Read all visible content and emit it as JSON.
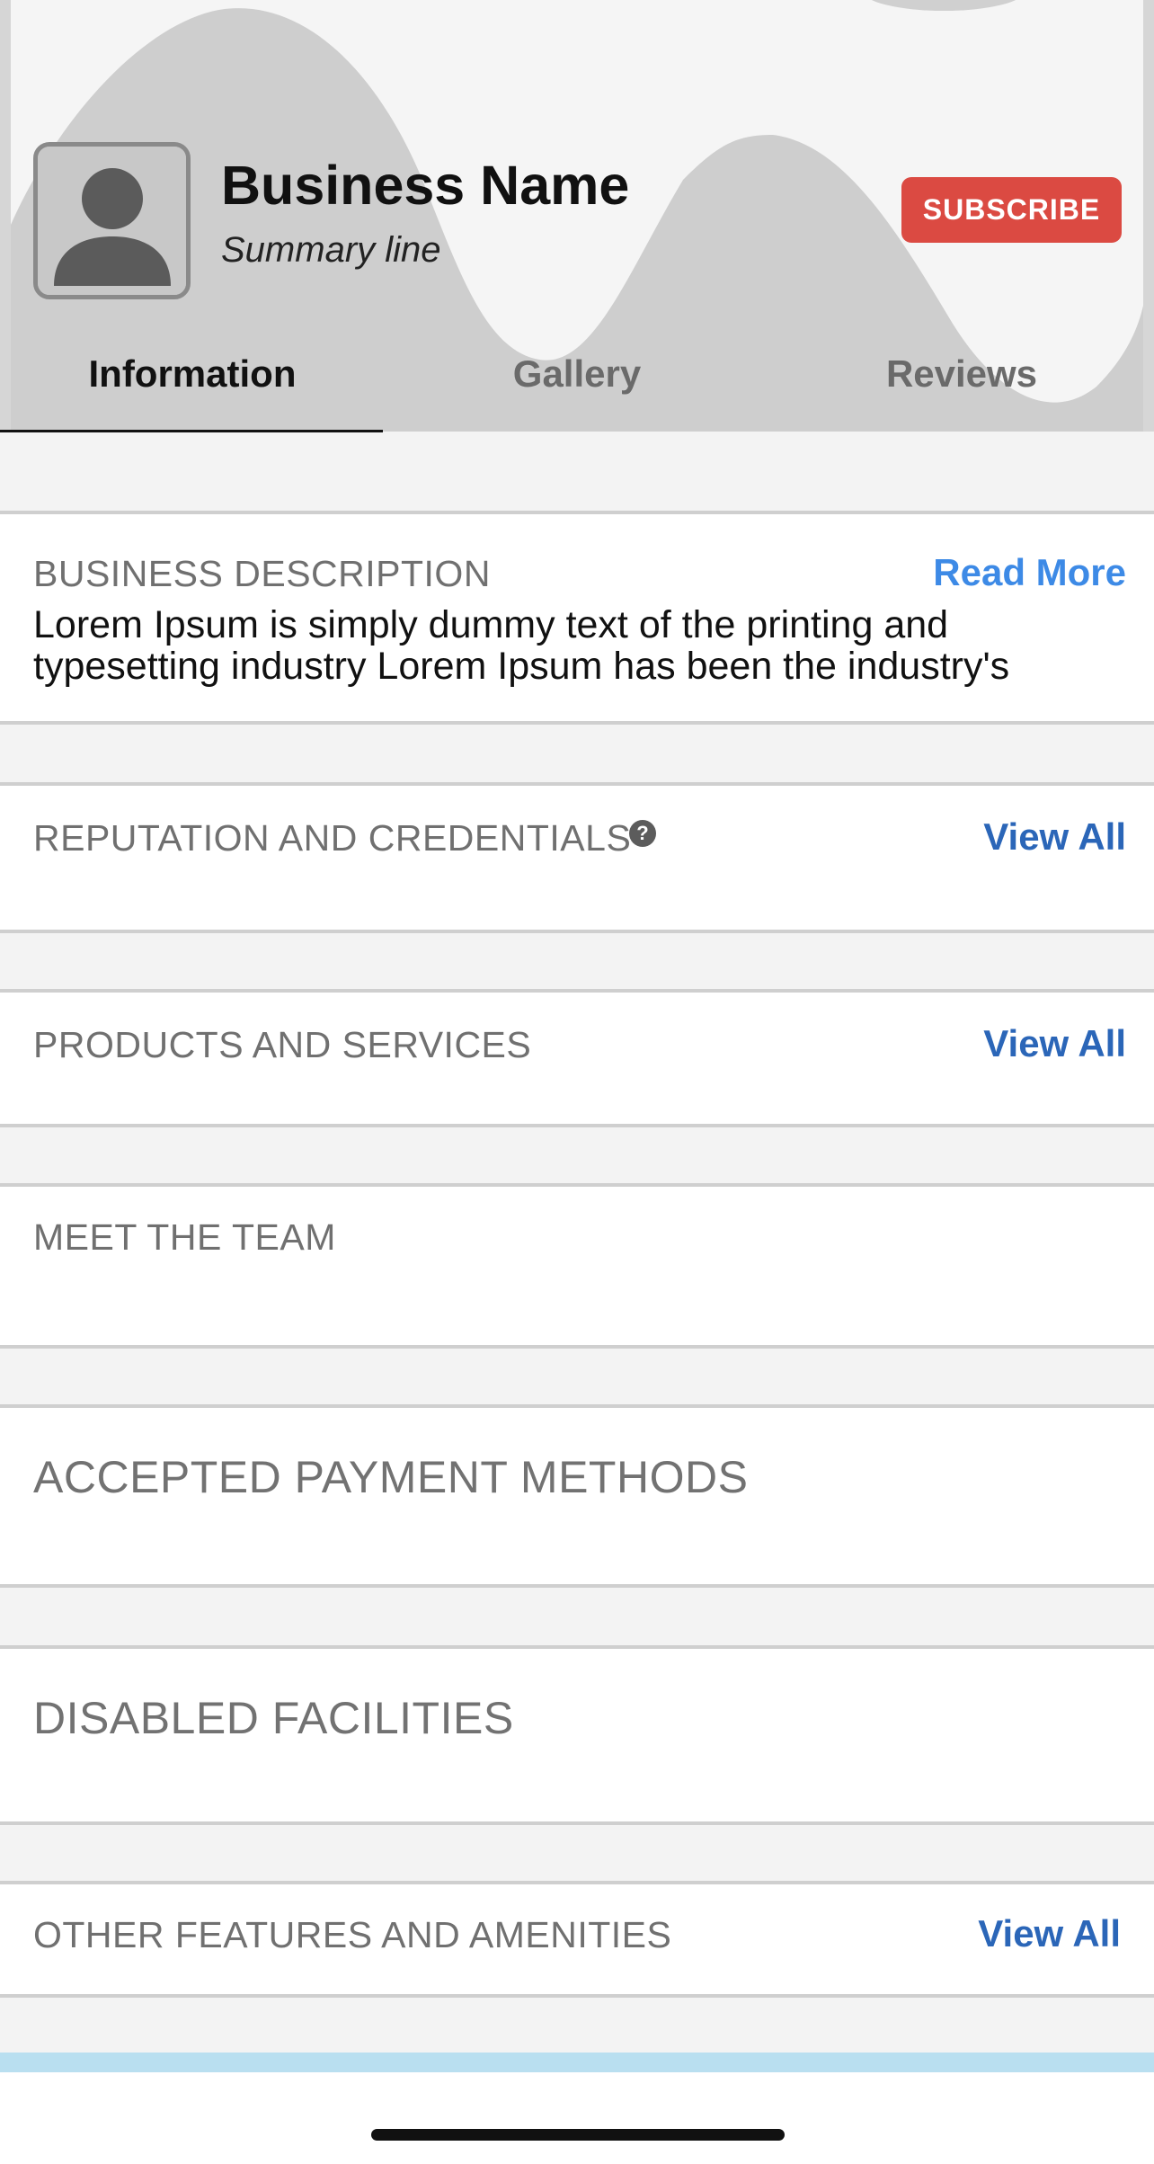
{
  "header": {
    "business_name": "Business Name",
    "summary": "Summary line",
    "subscribe_label": "SUBSCRIBE",
    "avatar_icon": "person-icon"
  },
  "tabs": [
    {
      "label": "Information",
      "active": true
    },
    {
      "label": "Gallery",
      "active": false
    },
    {
      "label": "Reviews",
      "active": false
    }
  ],
  "sections": {
    "business_description": {
      "title": "BUSINESS DESCRIPTION",
      "link": "Read More",
      "text": "Lorem Ipsum is simply dummy text of the printing and typesetting industry Lorem Ipsum has been the industry's"
    },
    "reputation": {
      "title": "REPUTATION AND CREDENTIALS",
      "link": "View All",
      "help_icon": "?"
    },
    "products": {
      "title": "PRODUCTS AND SERVICES",
      "link": "View All"
    },
    "team": {
      "title": "MEET THE TEAM"
    },
    "payment": {
      "title": "ACCEPTED PAYMENT METHODS"
    },
    "disabled": {
      "title": "DISABLED FACILITIES"
    },
    "amenities": {
      "title": "OTHER FEATURES AND AMENITIES",
      "link": "View All"
    }
  },
  "colors": {
    "subscribe_bg": "#db4a42",
    "link": "#2b66b8",
    "link_light": "#3d8ae6",
    "text_muted": "#707070"
  }
}
